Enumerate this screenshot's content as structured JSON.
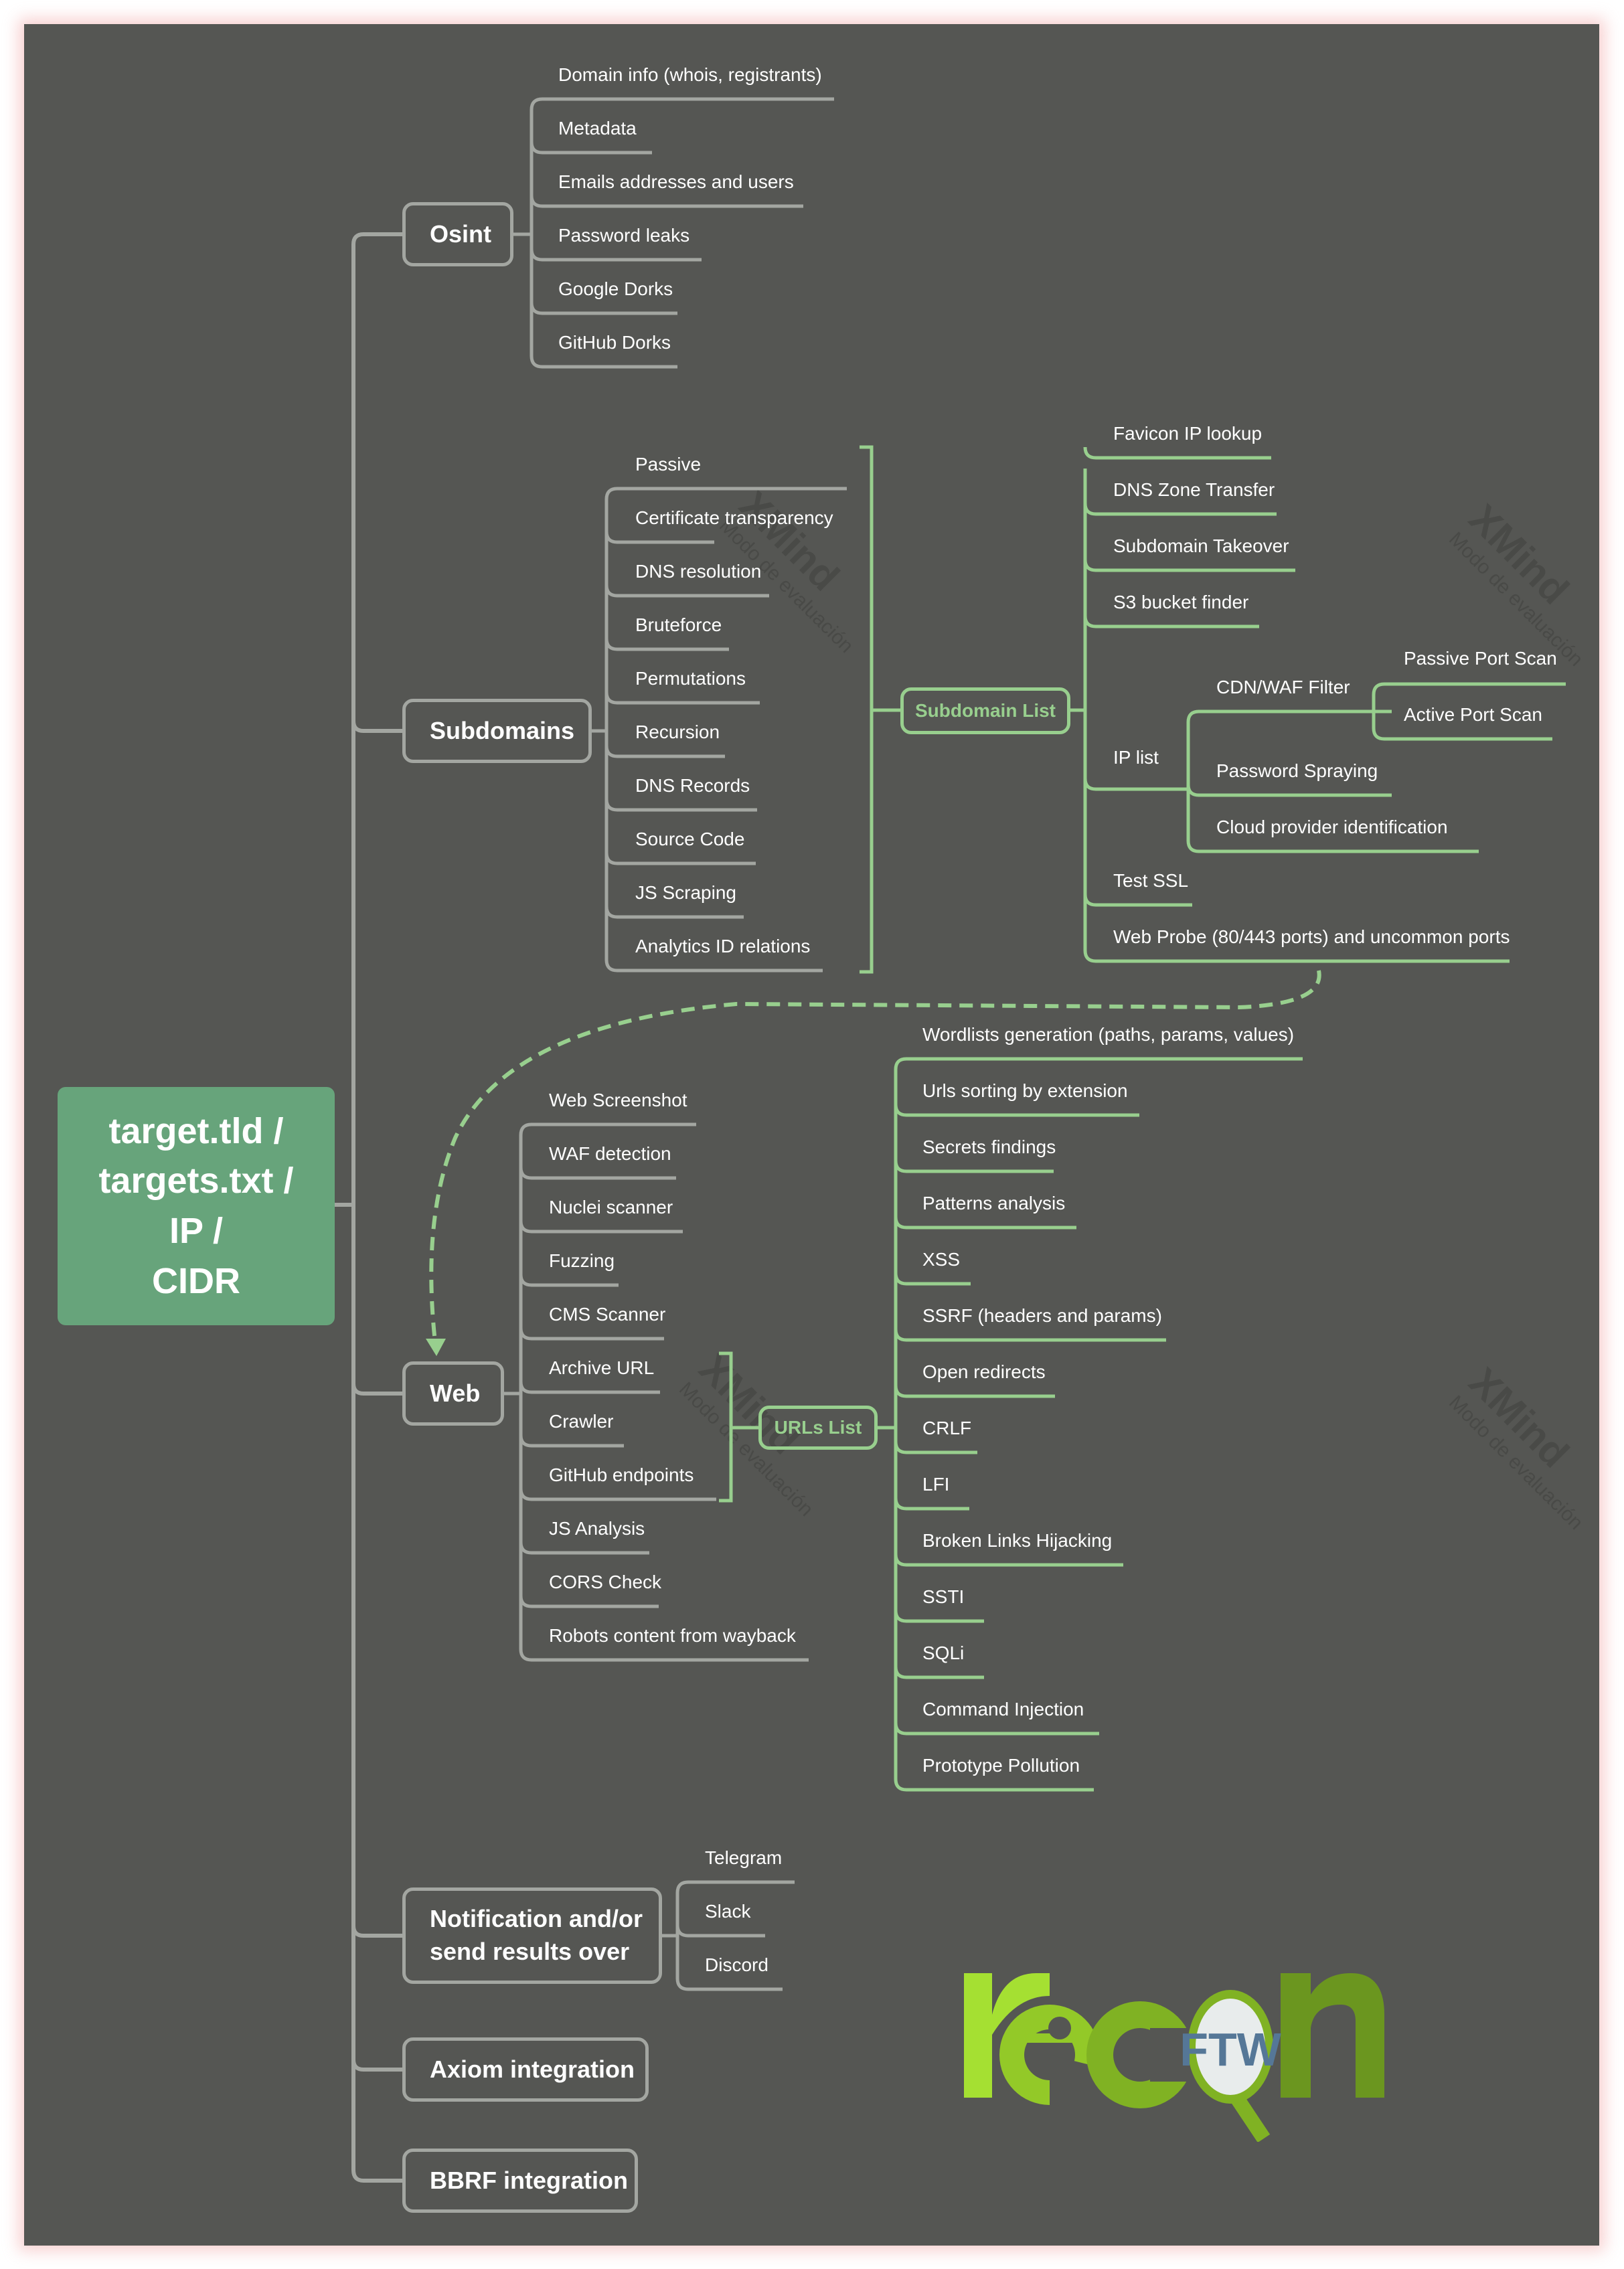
{
  "root": {
    "lines": [
      "target.tld /",
      "targets.txt /",
      "IP /",
      "CIDR"
    ]
  },
  "branches": {
    "osint": {
      "label": "Osint",
      "children": [
        "Domain info (whois, registrants)",
        "Metadata",
        "Emails addresses and users",
        "Password leaks",
        "Google Dorks",
        "GitHub Dorks"
      ]
    },
    "subdomains": {
      "label": "Subdomains",
      "children": [
        "Passive",
        "Certificate transparency",
        "DNS resolution",
        "Bruteforce",
        "Permutations",
        "Recursion",
        "DNS Records",
        "Source Code",
        "JS Scraping",
        "Analytics ID relations"
      ],
      "summary": {
        "label": "Subdomain List",
        "children": [
          "Favicon IP lookup",
          "DNS Zone Transfer",
          "Subdomain Takeover",
          "S3 bucket finder",
          "IP list",
          "Test SSL",
          "Web Probe (80/443 ports) and uncommon ports"
        ],
        "ip_list": {
          "cdn_waf": {
            "label": "CDN/WAF Filter",
            "children": [
              "Passive Port Scan",
              "Active Port Scan"
            ]
          },
          "others": [
            "Password Spraying",
            "Cloud provider identification"
          ]
        }
      }
    },
    "web": {
      "label": "Web",
      "children": [
        "Web Screenshot",
        "WAF detection",
        "Nuclei scanner",
        "Fuzzing",
        "CMS Scanner",
        "Archive URL",
        "Crawler",
        "GitHub endpoints",
        "JS Analysis",
        "CORS Check",
        "Robots content from wayback"
      ],
      "summary": {
        "label": "URLs List",
        "children": [
          "Wordlists generation (paths, params, values)",
          "Urls sorting by extension",
          "Secrets findings",
          "Patterns analysis",
          "XSS",
          "SSRF (headers and params)",
          "Open redirects",
          "CRLF",
          "LFI",
          "Broken Links Hijacking",
          "SSTI",
          "SQLi",
          "Command Injection",
          "Prototype Pollution"
        ]
      }
    },
    "notification": {
      "label_lines": [
        "Notification and/or",
        "send results over"
      ],
      "children": [
        "Telegram",
        "Slack",
        "Discord"
      ]
    },
    "axiom": {
      "label": "Axiom integration"
    },
    "bbrf": {
      "label": "BBRF integration"
    }
  },
  "watermark": {
    "brand": "XMind",
    "text": "Modo de evaluación"
  },
  "logo": {
    "text": "recon",
    "badge": "FTW"
  },
  "colors": {
    "background": "#555653",
    "gray_line": "#a3a6a1",
    "green_line": "#98cf8e",
    "root_fill": "#67a47b",
    "logo_light": "#a5e032",
    "logo_dark": "#6b961f",
    "badge_text": "#557797"
  }
}
